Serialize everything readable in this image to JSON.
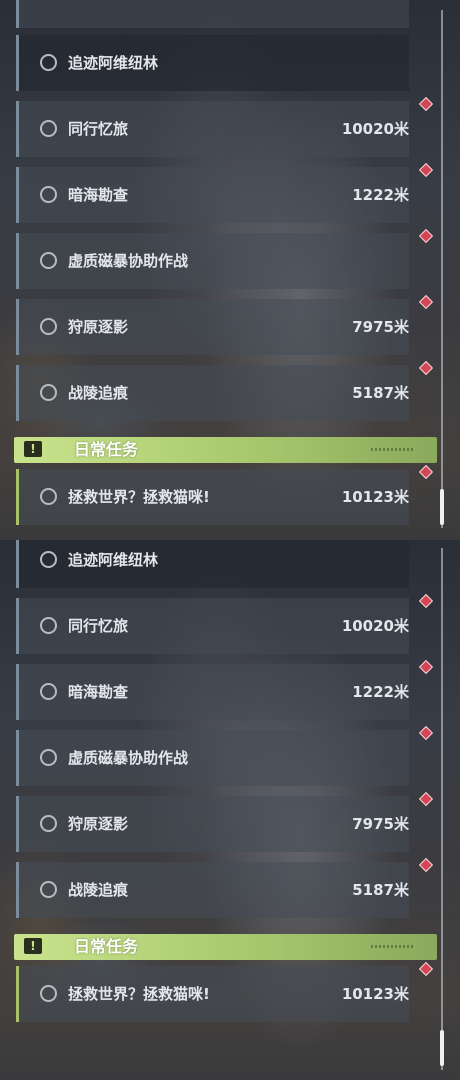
{
  "panels": [
    {
      "tasks": [
        {
          "name": "追迹阿维纽林",
          "distance": ""
        },
        {
          "name": "同行忆旅",
          "distance": "10020米"
        },
        {
          "name": "暗海勘查",
          "distance": "1222米"
        },
        {
          "name": "虚质磁暴协助作战",
          "distance": ""
        },
        {
          "name": "狩原逐影",
          "distance": "7975米"
        },
        {
          "name": "战陵追痕",
          "distance": "5187米"
        }
      ],
      "daily_header": {
        "badge": "!",
        "title": "日常任务"
      },
      "daily_tasks": [
        {
          "name": "拯救世界？拯救猫咪!",
          "distance": "10123米"
        }
      ]
    },
    {
      "tasks": [
        {
          "name": "追迹阿维纽林",
          "distance": ""
        },
        {
          "name": "同行忆旅",
          "distance": "10020米"
        },
        {
          "name": "暗海勘查",
          "distance": "1222米"
        },
        {
          "name": "虚质磁暴协助作战",
          "distance": ""
        },
        {
          "name": "狩原逐影",
          "distance": "7975米"
        },
        {
          "name": "战陵追痕",
          "distance": "5187米"
        }
      ],
      "daily_header": {
        "badge": "!",
        "title": "日常任务"
      },
      "daily_tasks": [
        {
          "name": "拯救世界？拯救猫咪!",
          "distance": "10123米"
        }
      ]
    }
  ],
  "colors": {
    "main_quest_accent": "#7b8d9c",
    "daily_accent": "#a9c266",
    "pin": "#d24655"
  }
}
